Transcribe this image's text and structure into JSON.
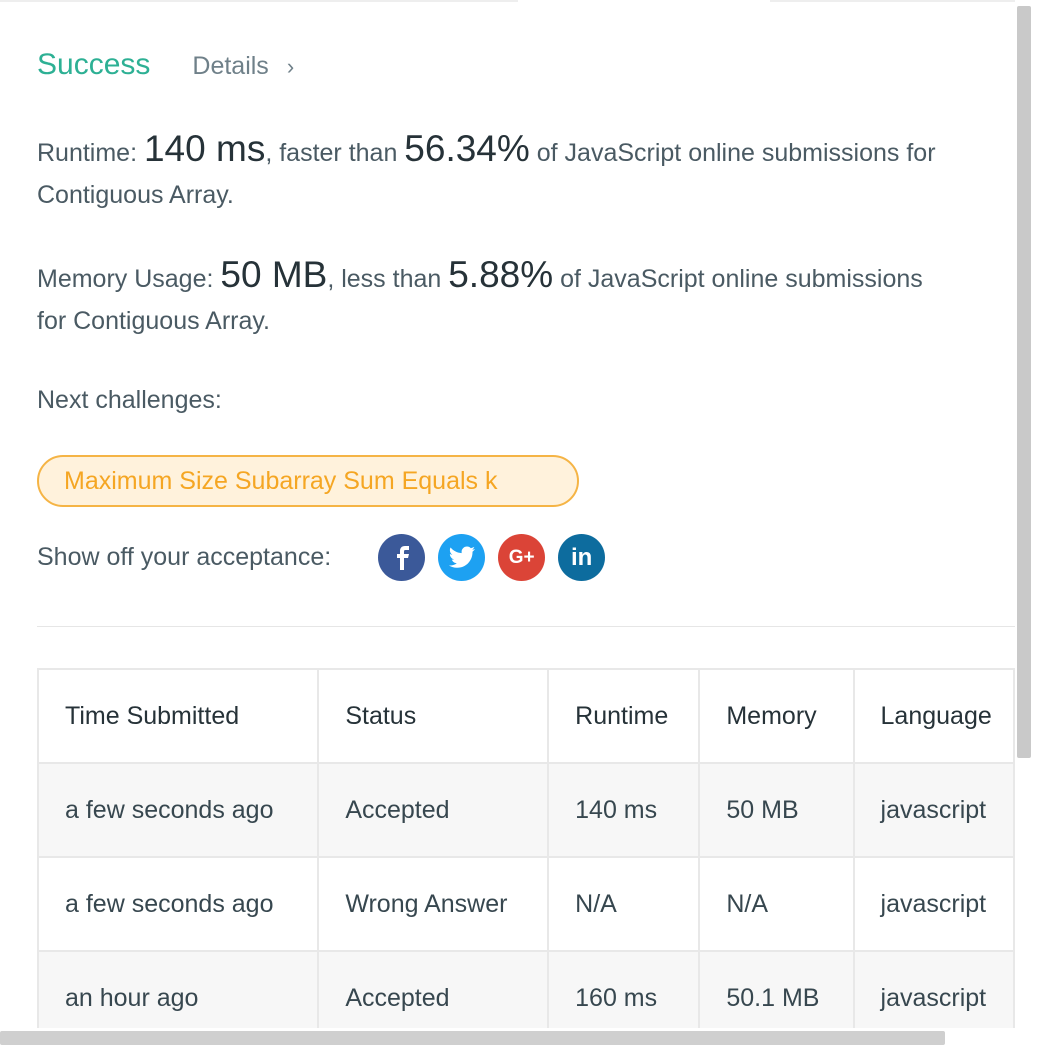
{
  "result": {
    "status": "Success",
    "details_label": "Details",
    "chevron": "›"
  },
  "runtime": {
    "label": "Runtime: ",
    "value": "140 ms",
    "compare_text": ", faster than ",
    "percent": "56.34%",
    "suffix": " of JavaScript online submissions for Contiguous Array."
  },
  "memory": {
    "label": "Memory Usage: ",
    "value": "50 MB",
    "compare_text": ", less than ",
    "percent": "5.88%",
    "suffix": " of JavaScript online submissions for Contiguous Array."
  },
  "next": {
    "label": "Next challenges:",
    "challenge": "Maximum Size Subarray Sum Equals k"
  },
  "share": {
    "label": "Show off your acceptance:",
    "buttons": [
      {
        "icon": "facebook-icon",
        "glyph": "f",
        "color": "#3b5999"
      },
      {
        "icon": "twitter-icon",
        "glyph": "🐦",
        "color": "#1da1f2"
      },
      {
        "icon": "google-plus-icon",
        "glyph": "G+",
        "color": "#db4437"
      },
      {
        "icon": "linkedin-icon",
        "glyph": "in",
        "color": "#0d6c9e"
      }
    ]
  },
  "table": {
    "headers": [
      "Time Submitted",
      "Status",
      "Runtime",
      "Memory",
      "Language"
    ],
    "rows": [
      [
        "a few seconds ago",
        "Accepted",
        "140 ms",
        "50 MB",
        "javascript"
      ],
      [
        "a few seconds ago",
        "Wrong Answer",
        "N/A",
        "N/A",
        "javascript"
      ],
      [
        "an hour ago",
        "Accepted",
        "160 ms",
        "50.1 MB",
        "javascript"
      ]
    ]
  },
  "colors": {
    "success": "#2db094",
    "wrong": "#d0343c",
    "challenge_text": "#f5a623",
    "challenge_border": "#f5b445"
  }
}
